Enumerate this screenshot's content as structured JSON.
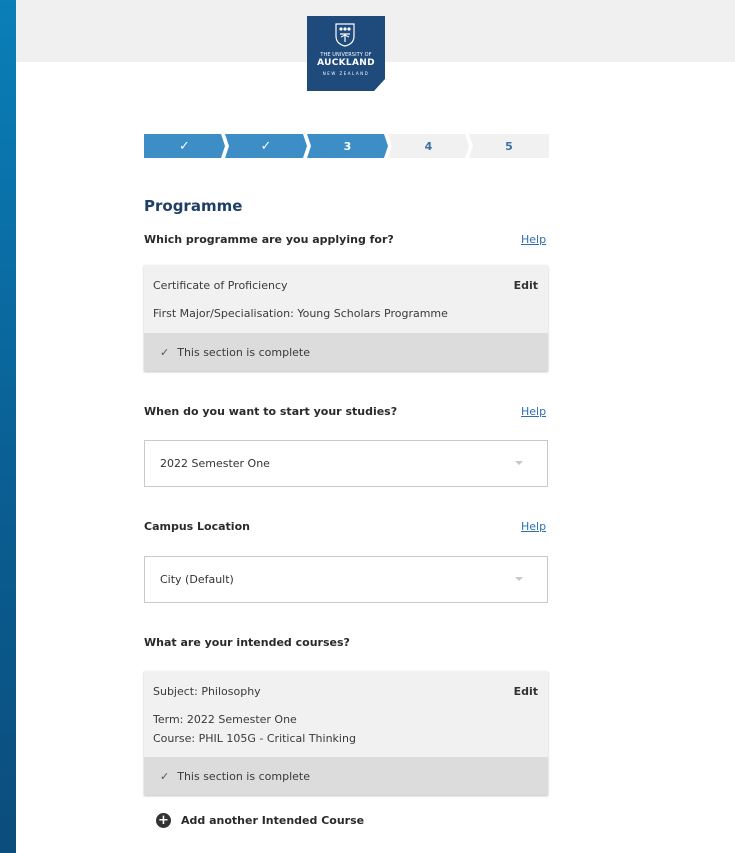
{
  "logo": {
    "line1": "THE UNIVERSITY OF",
    "line2": "AUCKLAND",
    "line3": "NEW ZEALAND"
  },
  "steps": [
    {
      "label": "✓",
      "state": "done"
    },
    {
      "label": "✓",
      "state": "done"
    },
    {
      "label": "3",
      "state": "active"
    },
    {
      "label": "4",
      "state": "todo"
    },
    {
      "label": "5",
      "state": "todo"
    }
  ],
  "section": {
    "title": "Programme"
  },
  "programme": {
    "question": "Which programme are you applying for?",
    "help": "Help",
    "line1": "Certificate of Proficiency",
    "line2": "First Major/Specialisation: Young Scholars Programme",
    "edit": "Edit",
    "complete_icon": "✓",
    "complete": "This section is complete"
  },
  "start": {
    "question": "When do you want to start your studies?",
    "help": "Help",
    "value": "2022 Semester One"
  },
  "campus": {
    "question": "Campus Location",
    "help": "Help",
    "value": "City (Default)"
  },
  "courses": {
    "question": "What are your intended courses?",
    "line1": "Subject: Philosophy",
    "line2": "Term: 2022 Semester One",
    "line3": "Course: PHIL 105G - Critical Thinking",
    "edit": "Edit",
    "complete_icon": "✓",
    "complete": "This section is complete",
    "add_icon": "+",
    "add": "Add another Intended Course"
  },
  "colors": {
    "brand_navy": "#1f4a7c",
    "step_active": "#3d8dc7",
    "link": "#2d6fb0"
  }
}
